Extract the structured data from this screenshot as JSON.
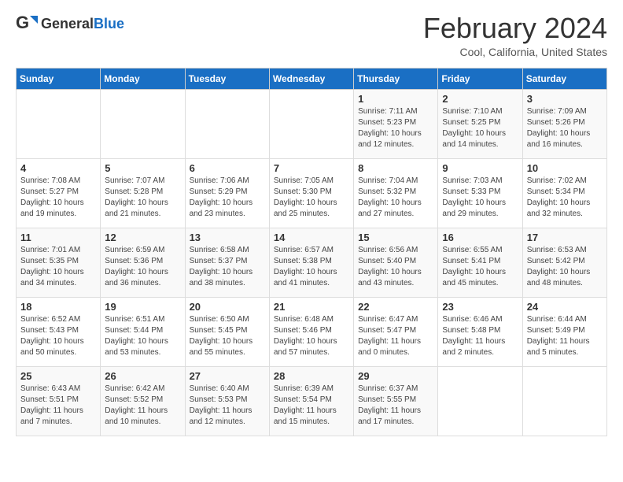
{
  "logo": {
    "text_general": "General",
    "text_blue": "Blue"
  },
  "header": {
    "title": "February 2024",
    "subtitle": "Cool, California, United States"
  },
  "days_of_week": [
    "Sunday",
    "Monday",
    "Tuesday",
    "Wednesday",
    "Thursday",
    "Friday",
    "Saturday"
  ],
  "weeks": [
    [
      {
        "day": "",
        "info": ""
      },
      {
        "day": "",
        "info": ""
      },
      {
        "day": "",
        "info": ""
      },
      {
        "day": "",
        "info": ""
      },
      {
        "day": "1",
        "info": "Sunrise: 7:11 AM\nSunset: 5:23 PM\nDaylight: 10 hours\nand 12 minutes."
      },
      {
        "day": "2",
        "info": "Sunrise: 7:10 AM\nSunset: 5:25 PM\nDaylight: 10 hours\nand 14 minutes."
      },
      {
        "day": "3",
        "info": "Sunrise: 7:09 AM\nSunset: 5:26 PM\nDaylight: 10 hours\nand 16 minutes."
      }
    ],
    [
      {
        "day": "4",
        "info": "Sunrise: 7:08 AM\nSunset: 5:27 PM\nDaylight: 10 hours\nand 19 minutes."
      },
      {
        "day": "5",
        "info": "Sunrise: 7:07 AM\nSunset: 5:28 PM\nDaylight: 10 hours\nand 21 minutes."
      },
      {
        "day": "6",
        "info": "Sunrise: 7:06 AM\nSunset: 5:29 PM\nDaylight: 10 hours\nand 23 minutes."
      },
      {
        "day": "7",
        "info": "Sunrise: 7:05 AM\nSunset: 5:30 PM\nDaylight: 10 hours\nand 25 minutes."
      },
      {
        "day": "8",
        "info": "Sunrise: 7:04 AM\nSunset: 5:32 PM\nDaylight: 10 hours\nand 27 minutes."
      },
      {
        "day": "9",
        "info": "Sunrise: 7:03 AM\nSunset: 5:33 PM\nDaylight: 10 hours\nand 29 minutes."
      },
      {
        "day": "10",
        "info": "Sunrise: 7:02 AM\nSunset: 5:34 PM\nDaylight: 10 hours\nand 32 minutes."
      }
    ],
    [
      {
        "day": "11",
        "info": "Sunrise: 7:01 AM\nSunset: 5:35 PM\nDaylight: 10 hours\nand 34 minutes."
      },
      {
        "day": "12",
        "info": "Sunrise: 6:59 AM\nSunset: 5:36 PM\nDaylight: 10 hours\nand 36 minutes."
      },
      {
        "day": "13",
        "info": "Sunrise: 6:58 AM\nSunset: 5:37 PM\nDaylight: 10 hours\nand 38 minutes."
      },
      {
        "day": "14",
        "info": "Sunrise: 6:57 AM\nSunset: 5:38 PM\nDaylight: 10 hours\nand 41 minutes."
      },
      {
        "day": "15",
        "info": "Sunrise: 6:56 AM\nSunset: 5:40 PM\nDaylight: 10 hours\nand 43 minutes."
      },
      {
        "day": "16",
        "info": "Sunrise: 6:55 AM\nSunset: 5:41 PM\nDaylight: 10 hours\nand 45 minutes."
      },
      {
        "day": "17",
        "info": "Sunrise: 6:53 AM\nSunset: 5:42 PM\nDaylight: 10 hours\nand 48 minutes."
      }
    ],
    [
      {
        "day": "18",
        "info": "Sunrise: 6:52 AM\nSunset: 5:43 PM\nDaylight: 10 hours\nand 50 minutes."
      },
      {
        "day": "19",
        "info": "Sunrise: 6:51 AM\nSunset: 5:44 PM\nDaylight: 10 hours\nand 53 minutes."
      },
      {
        "day": "20",
        "info": "Sunrise: 6:50 AM\nSunset: 5:45 PM\nDaylight: 10 hours\nand 55 minutes."
      },
      {
        "day": "21",
        "info": "Sunrise: 6:48 AM\nSunset: 5:46 PM\nDaylight: 10 hours\nand 57 minutes."
      },
      {
        "day": "22",
        "info": "Sunrise: 6:47 AM\nSunset: 5:47 PM\nDaylight: 11 hours\nand 0 minutes."
      },
      {
        "day": "23",
        "info": "Sunrise: 6:46 AM\nSunset: 5:48 PM\nDaylight: 11 hours\nand 2 minutes."
      },
      {
        "day": "24",
        "info": "Sunrise: 6:44 AM\nSunset: 5:49 PM\nDaylight: 11 hours\nand 5 minutes."
      }
    ],
    [
      {
        "day": "25",
        "info": "Sunrise: 6:43 AM\nSunset: 5:51 PM\nDaylight: 11 hours\nand 7 minutes."
      },
      {
        "day": "26",
        "info": "Sunrise: 6:42 AM\nSunset: 5:52 PM\nDaylight: 11 hours\nand 10 minutes."
      },
      {
        "day": "27",
        "info": "Sunrise: 6:40 AM\nSunset: 5:53 PM\nDaylight: 11 hours\nand 12 minutes."
      },
      {
        "day": "28",
        "info": "Sunrise: 6:39 AM\nSunset: 5:54 PM\nDaylight: 11 hours\nand 15 minutes."
      },
      {
        "day": "29",
        "info": "Sunrise: 6:37 AM\nSunset: 5:55 PM\nDaylight: 11 hours\nand 17 minutes."
      },
      {
        "day": "",
        "info": ""
      },
      {
        "day": "",
        "info": ""
      }
    ]
  ]
}
